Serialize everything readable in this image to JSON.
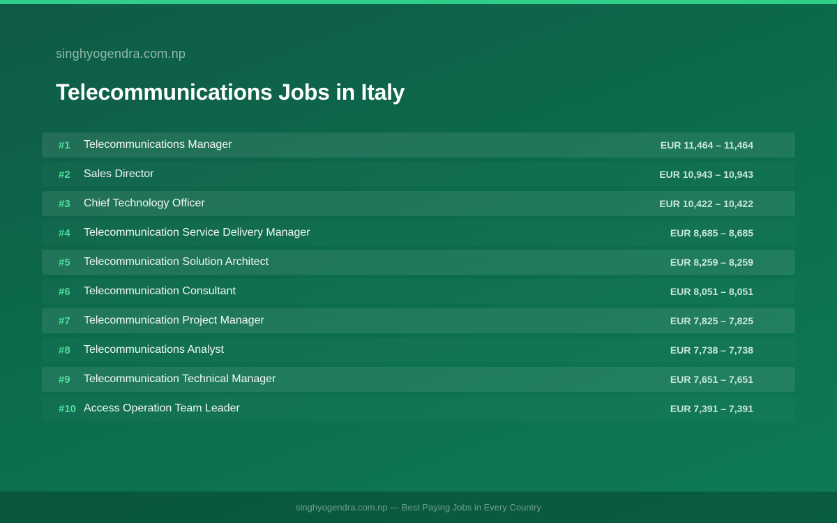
{
  "site_name": "singhyogendra.com.np",
  "title": "Telecommunications Jobs in Italy",
  "jobs": [
    {
      "rank": "#1",
      "title": "Telecommunications Manager",
      "salary": "EUR 11,464 – 11,464"
    },
    {
      "rank": "#2",
      "title": "Sales Director",
      "salary": "EUR 10,943 – 10,943"
    },
    {
      "rank": "#3",
      "title": "Chief Technology Officer",
      "salary": "EUR 10,422 – 10,422"
    },
    {
      "rank": "#4",
      "title": "Telecommunication Service Delivery Manager",
      "salary": "EUR 8,685 – 8,685"
    },
    {
      "rank": "#5",
      "title": "Telecommunication Solution Architect",
      "salary": "EUR 8,259 – 8,259"
    },
    {
      "rank": "#6",
      "title": "Telecommunication Consultant",
      "salary": "EUR 8,051 – 8,051"
    },
    {
      "rank": "#7",
      "title": "Telecommunication Project Manager",
      "salary": "EUR 7,825 – 7,825"
    },
    {
      "rank": "#8",
      "title": "Telecommunications Analyst",
      "salary": "EUR 7,738 – 7,738"
    },
    {
      "rank": "#9",
      "title": "Telecommunication Technical Manager",
      "salary": "EUR 7,651 – 7,651"
    },
    {
      "rank": "#10",
      "title": "Access Operation Team Leader",
      "salary": "EUR 7,391 – 7,391"
    }
  ],
  "footer": "singhyogendra.com.np — Best Paying Jobs in Every Country",
  "colors": {
    "accent": "#2fcf8a",
    "rank": "#4fdc9a",
    "background": "#0c6b4c"
  }
}
